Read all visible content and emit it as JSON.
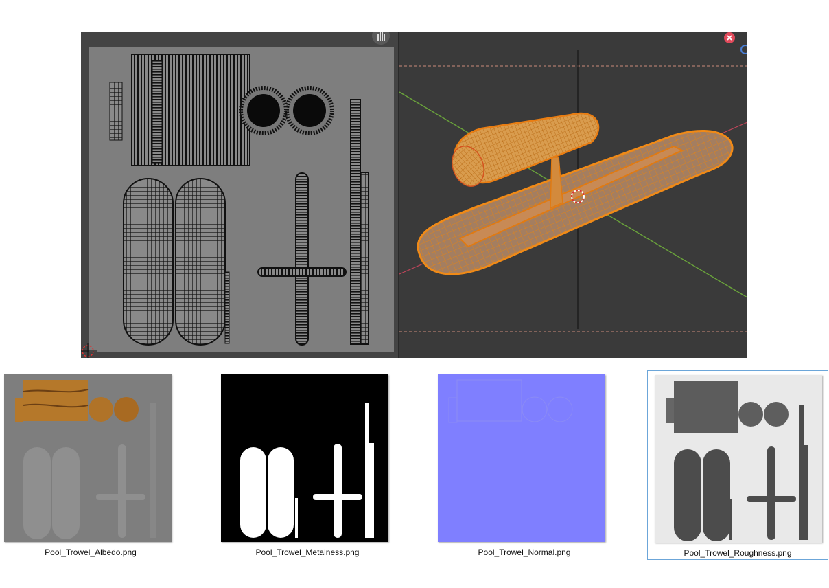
{
  "textures": [
    {
      "filename": "Pool_Trowel_Albedo.png",
      "map": "albedo"
    },
    {
      "filename": "Pool_Trowel_Metalness.png",
      "map": "metalness"
    },
    {
      "filename": "Pool_Trowel_Normal.png",
      "map": "normal"
    },
    {
      "filename": "Pool_Trowel_Roughness.png",
      "map": "roughness",
      "selected": true
    }
  ],
  "colors": {
    "uv_background": "#7e7e7e",
    "editor_background": "#3a3a3a",
    "mesh_selected": "#e8891a",
    "normal_map": "#7f7fff",
    "selection_border": "#6ca6d9",
    "axis_x": "#c0455a",
    "axis_y": "#6aa33b"
  },
  "icons": {
    "uv_gizmo": "hand-icon",
    "uv_cursor": "2d-cursor-icon",
    "viewport_close": "close-icon",
    "viewport_nav": "navigation-gizmo-icon"
  }
}
